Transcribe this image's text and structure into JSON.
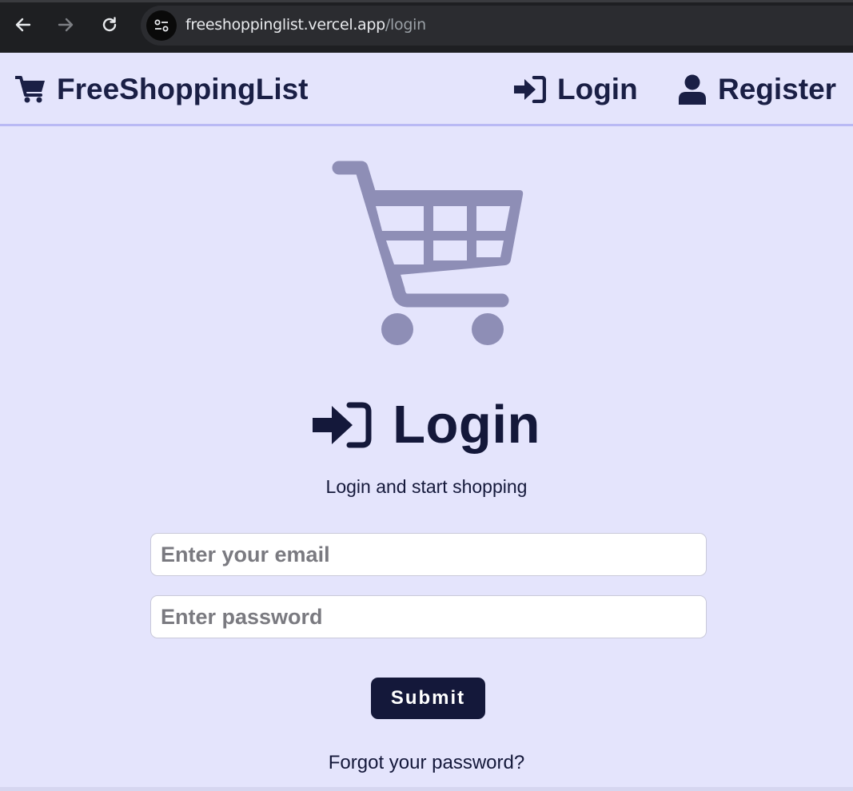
{
  "browser": {
    "url_host": "freeshoppinglist.vercel.app",
    "url_path": "/login",
    "icons": [
      "arrow-left-icon",
      "arrow-right-icon",
      "reload-icon",
      "site-info-icon"
    ]
  },
  "header": {
    "brand": "FreeShoppingList",
    "brand_icon": "shopping-cart-icon",
    "nav": {
      "login": "Login",
      "login_icon": "sign-in-icon",
      "register": "Register",
      "register_icon": "user-icon"
    }
  },
  "main": {
    "hero_icon": "shopping-cart-icon",
    "title": "Login",
    "title_icon": "sign-in-icon",
    "subtitle": "Login and start shopping"
  },
  "form": {
    "email_placeholder": "Enter your email",
    "email_value": "",
    "password_placeholder": "Enter password",
    "password_value": "",
    "submit_label": "Submit",
    "forgot_label": "Forgot your password?"
  },
  "colors": {
    "page_background": "#e4e4fc",
    "primary_text": "#14183a",
    "header_border": "#b9b9f4",
    "hero_icon": "#8e8eb6",
    "button_background": "#14183a",
    "button_text": "#ffffff"
  }
}
